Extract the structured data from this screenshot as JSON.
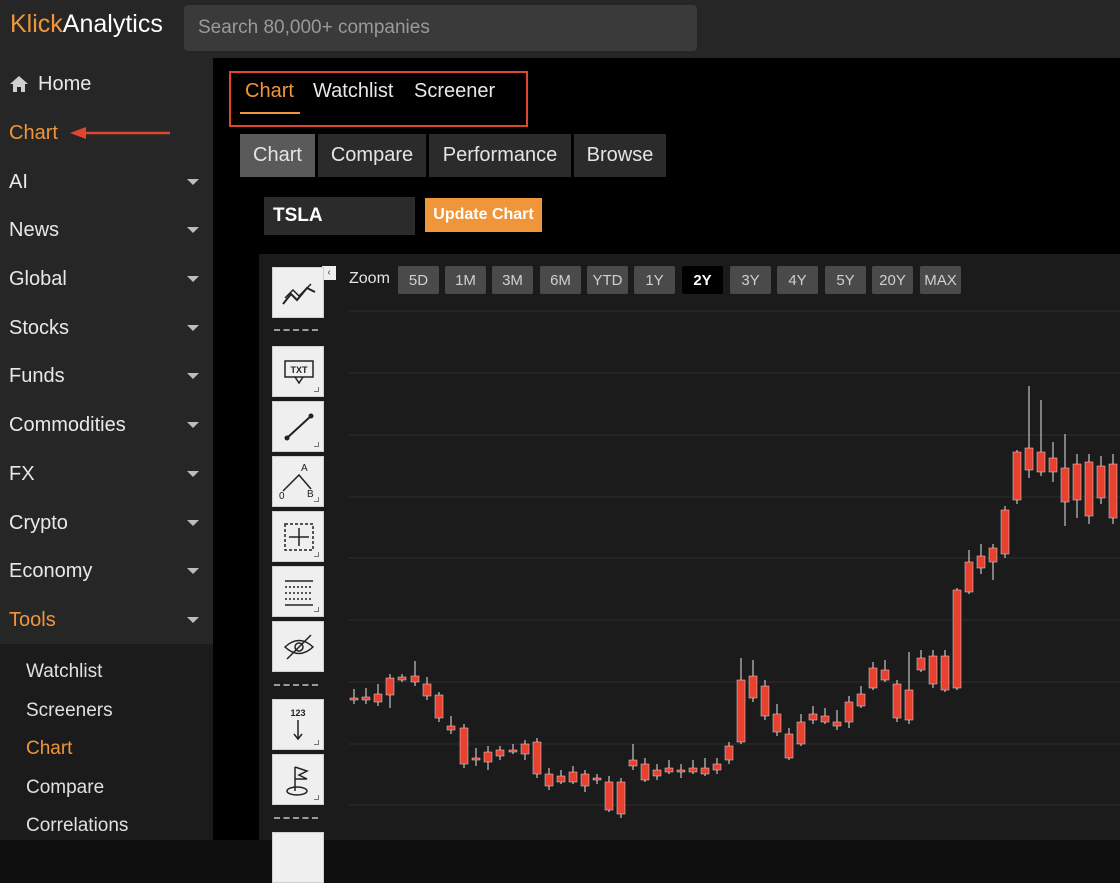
{
  "header": {
    "logo_prefix": "Klick",
    "logo_suffix": "Analytics",
    "search_placeholder": "Search 80,000+ companies"
  },
  "sidebar": {
    "items": [
      {
        "label": "Home",
        "icon": "home-icon"
      },
      {
        "label": "Chart",
        "active": true
      },
      {
        "label": "AI"
      },
      {
        "label": "News"
      },
      {
        "label": "Global"
      },
      {
        "label": "Stocks"
      },
      {
        "label": "Funds"
      },
      {
        "label": "Commodities"
      },
      {
        "label": "FX"
      },
      {
        "label": "Crypto"
      },
      {
        "label": "Economy"
      },
      {
        "label": "Tools",
        "active": true
      }
    ],
    "submenu": [
      "Watchlist",
      "Screeners",
      "Chart",
      "Compare",
      "Correlations"
    ]
  },
  "main": {
    "tabs": [
      "Chart",
      "Watchlist",
      "Screener"
    ],
    "subtabs": [
      "Chart",
      "Compare",
      "Performance",
      "Browse"
    ],
    "ticker_value": "TSLA",
    "update_label": "Update Chart",
    "zoom_label": "Zoom",
    "zoom_options": [
      "5D",
      "1M",
      "3M",
      "6M",
      "YTD",
      "1Y",
      "2Y",
      "3Y",
      "4Y",
      "5Y",
      "20Y",
      "MAX"
    ],
    "zoom_selected": "2Y"
  },
  "colors": {
    "accent": "#f0963a",
    "highlight_box": "#e0452e",
    "candle_up": "#5cb85c",
    "candle_down": "#e8412f"
  },
  "tools": [
    "trend-lines-icon",
    "text-label-icon",
    "line-icon",
    "pattern-abc-icon",
    "measure-icon",
    "fibonacci-icon",
    "hide-icon",
    "count-icon",
    "flag-icon"
  ]
}
